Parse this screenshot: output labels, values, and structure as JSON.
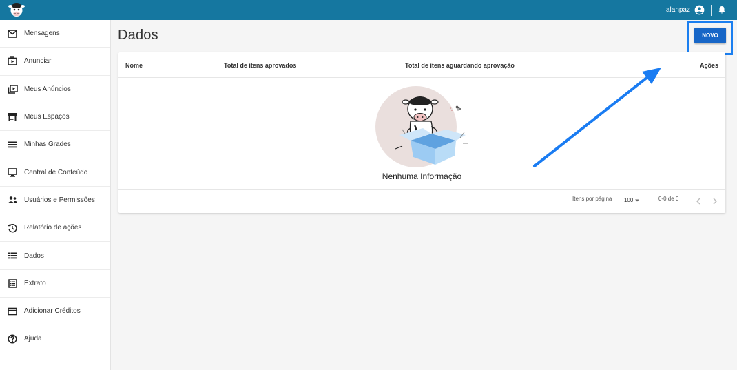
{
  "topbar": {
    "username": "alanpaz",
    "colors": {
      "background": "#1577a0",
      "accent": "#1766c7"
    }
  },
  "sidebar": {
    "items": [
      {
        "label": "Mensagens",
        "icon": "mail-icon"
      },
      {
        "label": "Anunciar",
        "icon": "play-box-icon"
      },
      {
        "label": "Meus Anúncios",
        "icon": "video-library-icon"
      },
      {
        "label": "Meus Espaços",
        "icon": "store-icon"
      },
      {
        "label": "Minhas Grades",
        "icon": "grid-lines-icon"
      },
      {
        "label": "Central de Conteúdo",
        "icon": "monitor-icon"
      },
      {
        "label": "Usuários e Permissões",
        "icon": "users-icon"
      },
      {
        "label": "Relatório de ações",
        "icon": "history-icon"
      },
      {
        "label": "Dados",
        "icon": "list-icon"
      },
      {
        "label": "Extrato",
        "icon": "receipt-icon"
      },
      {
        "label": "Adicionar Créditos",
        "icon": "credit-card-icon"
      },
      {
        "label": "Ajuda",
        "icon": "help-icon"
      }
    ]
  },
  "main": {
    "title": "Dados",
    "new_button": "NOVO",
    "table": {
      "columns": [
        "Nome",
        "Total de itens aprovados",
        "Total de itens aguardando aprovação",
        "Ações"
      ],
      "empty_message": "Nenhuma Informação"
    },
    "pagination": {
      "per_page_label": "Itens por página",
      "per_page_value": "100",
      "range": "0-0 de 0"
    }
  }
}
